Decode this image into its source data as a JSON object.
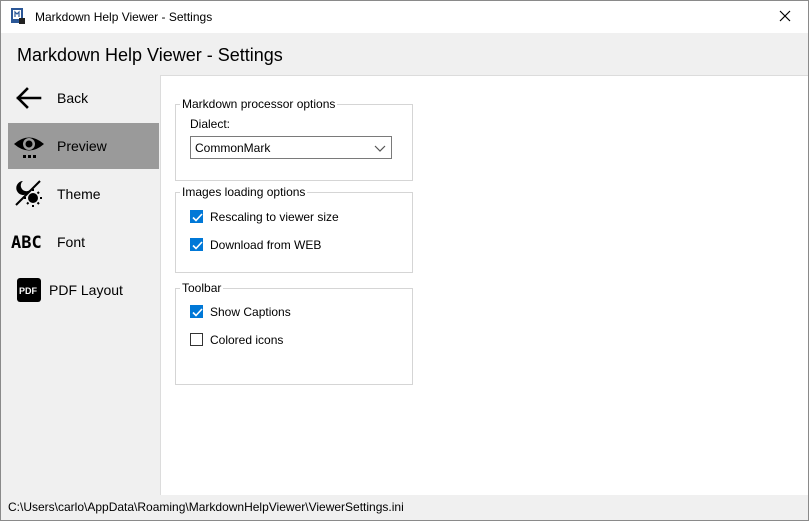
{
  "window": {
    "title": "Markdown Help Viewer - Settings",
    "app_icon": "markdown-app-icon",
    "close_icon": "close-icon"
  },
  "header": {
    "title": "Markdown Help Viewer - Settings"
  },
  "sidebar": {
    "active_index": 1,
    "active_color": "#9a9a9a",
    "items": [
      {
        "label": "Back",
        "icon": "arrow-left-icon"
      },
      {
        "label": "Preview",
        "icon": "eye-icon"
      },
      {
        "label": "Theme",
        "icon": "theme-icon"
      },
      {
        "label": "Font",
        "icon": "font-abc-icon"
      },
      {
        "label": "PDF Layout",
        "icon": "pdf-icon"
      }
    ]
  },
  "main": {
    "markdown_group": {
      "title": "Markdown processor options",
      "dialect_label": "Dialect:",
      "dialect_value": "CommonMark"
    },
    "images_group": {
      "title": "Images loading options",
      "options": [
        {
          "label": "Rescaling to viewer size",
          "checked": true
        },
        {
          "label": "Download from WEB",
          "checked": true
        }
      ]
    },
    "toolbar_group": {
      "title": "Toolbar",
      "options": [
        {
          "label": "Show Captions",
          "checked": true
        },
        {
          "label": "Colored icons",
          "checked": false
        }
      ]
    },
    "accent_color": "#0078d7"
  },
  "statusbar": {
    "path": "C:\\Users\\carlo\\AppData\\Roaming\\MarkdownHelpViewer\\ViewerSettings.ini"
  }
}
